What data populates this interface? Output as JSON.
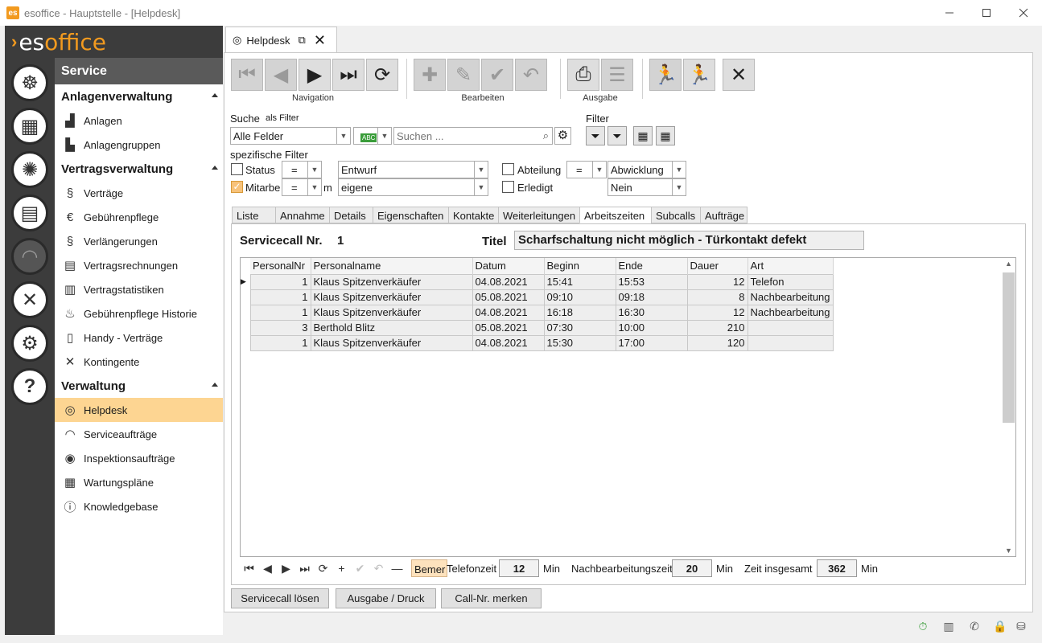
{
  "window": {
    "title": "esoffice - Hauptstelle - [Helpdesk]"
  },
  "logo": {
    "prefix": "es",
    "suffix": "office"
  },
  "sidebar": {
    "header": "Service",
    "groups": [
      {
        "label": "Anlagenverwaltung",
        "items": [
          {
            "label": "Anlagen",
            "icon": "factory-icon"
          },
          {
            "label": "Anlagengruppen",
            "icon": "factory-group-icon"
          }
        ]
      },
      {
        "label": "Vertragsverwaltung",
        "items": [
          {
            "label": "Verträge",
            "icon": "paragraph-icon"
          },
          {
            "label": "Gebührenpflege",
            "icon": "money-bag-icon"
          },
          {
            "label": "Verlängerungen",
            "icon": "paragraph-clock-icon"
          },
          {
            "label": "Vertragsrechnungen",
            "icon": "invoice-icon"
          },
          {
            "label": "Vertragstatistiken",
            "icon": "statistics-icon"
          },
          {
            "label": "Gebührenpflege Historie",
            "icon": "money-history-icon"
          },
          {
            "label": "Handy - Verträge",
            "icon": "mobile-phone-icon"
          },
          {
            "label": "Kontingente",
            "icon": "tools-icon"
          }
        ]
      },
      {
        "label": "Verwaltung",
        "items": [
          {
            "label": "Helpdesk",
            "icon": "lifebuoy-icon",
            "selected": true
          },
          {
            "label": "Serviceaufträge",
            "icon": "headset-icon"
          },
          {
            "label": "Inspektionsaufträge",
            "icon": "eye-icon"
          },
          {
            "label": "Wartungspläne",
            "icon": "calendar-icon"
          },
          {
            "label": "Knowledgebase",
            "icon": "info-book-icon"
          }
        ]
      }
    ]
  },
  "tab": {
    "label": "Helpdesk"
  },
  "toolbar": {
    "navigation_label": "Navigation",
    "edit_label": "Bearbeiten",
    "output_label": "Ausgabe"
  },
  "search": {
    "label": "Suche",
    "as_filter": "als Filter",
    "field_value": "Alle Felder",
    "placeholder": "Suchen ...",
    "filter_label": "Filter",
    "specific_label": "spezifische Filter"
  },
  "filters": {
    "status_label": "Status",
    "status_op": "=",
    "status_value": "Entwurf",
    "mitarb_label": "Mitarbe",
    "mitarb_op": "=",
    "mitarb_suffix": "m",
    "mitarb_value": "eigene",
    "abteilung_label": "Abteilung",
    "abteilung_op": "=",
    "abteilung_value": "Abwicklung",
    "erledigt_label": "Erledigt",
    "erledigt_value": "Nein"
  },
  "subtabs": [
    "Liste",
    "Annahme",
    "Details",
    "Eigenschaften",
    "Kontakte",
    "Weiterleitungen",
    "Arbeitszeiten",
    "Subcalls",
    "Aufträge"
  ],
  "detail": {
    "call_label": "Servicecall Nr.",
    "call_nr": "1",
    "title_label": "Titel",
    "title_value": "Scharfschaltung nicht möglich - Türkontakt defekt"
  },
  "grid": {
    "columns": [
      "PersonalNr",
      "Personalname",
      "Datum",
      "Beginn",
      "Ende",
      "Dauer",
      "Art"
    ],
    "rows": [
      [
        "1",
        "Klaus Spitzenverkäufer",
        "04.08.2021",
        "15:41",
        "15:53",
        "12",
        "Telefon"
      ],
      [
        "1",
        "Klaus Spitzenverkäufer",
        "05.08.2021",
        "09:10",
        "09:18",
        "8",
        "Nachbearbeitung"
      ],
      [
        "1",
        "Klaus Spitzenverkäufer",
        "04.08.2021",
        "16:18",
        "16:30",
        "12",
        "Nachbearbeitung"
      ],
      [
        "3",
        "Berthold Blitz",
        "05.08.2021",
        "07:30",
        "10:00",
        "210",
        ""
      ],
      [
        "1",
        "Klaus Spitzenverkäufer",
        "04.08.2021",
        "15:30",
        "17:00",
        "120",
        ""
      ]
    ]
  },
  "summary": {
    "bemer": "Bemer",
    "telefon_label": "Telefonzeit",
    "telefon_value": "12",
    "nach_label": "Nachbearbeitungszeit",
    "nach_value": "20",
    "gesamt_label": "Zeit insgesamt",
    "gesamt_value": "362",
    "unit": "Min"
  },
  "buttons": {
    "loesen": "Servicecall lösen",
    "druck": "Ausgabe / Druck",
    "merken": "Call-Nr. merken"
  }
}
